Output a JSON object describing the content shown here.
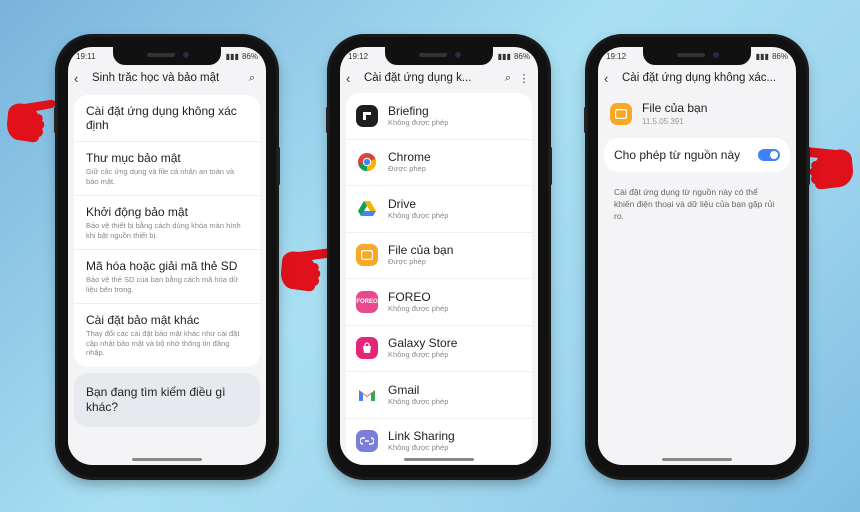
{
  "colors": {
    "accent": "#3e82f7",
    "hand": "#e0111b"
  },
  "phone1": {
    "status_time": "19:11",
    "battery": "86%",
    "toolbar_title": "Sinh trắc học và bảo mật",
    "items": [
      {
        "title": "Cài đặt ứng dụng không xác định",
        "subtitle": ""
      },
      {
        "title": "Thư mục bảo mật",
        "subtitle": "Giữ các ứng dụng và file cá nhân an toàn và bảo mật."
      },
      {
        "title": "Khởi động bảo mật",
        "subtitle": "Bảo vệ thiết bị bằng cách dùng khóa màn hình khi bật nguồn thiết bị."
      },
      {
        "title": "Mã hóa hoặc giải mã thẻ SD",
        "subtitle": "Bảo vệ thẻ SD của bạn bằng cách mã hóa dữ liệu bên trong."
      },
      {
        "title": "Cài đặt bảo mật khác",
        "subtitle": "Thay đổi các cài đặt bảo mật khác như cài đặt cập nhật bảo mật và bộ nhớ thông tin đăng nhập."
      }
    ],
    "search_prompt": "Bạn đang tìm kiếm điều gì khác?"
  },
  "phone2": {
    "status_time": "19:12",
    "battery": "86%",
    "toolbar_title": "Cài đặt ứng dụng k...",
    "apps": [
      {
        "name": "Briefing",
        "status": "Không được phép",
        "icon": "briefing-icon"
      },
      {
        "name": "Chrome",
        "status": "Được phép",
        "icon": "chrome-icon"
      },
      {
        "name": "Drive",
        "status": "Không được phép",
        "icon": "drive-icon"
      },
      {
        "name": "File của bạn",
        "status": "Được phép",
        "icon": "folder-icon"
      },
      {
        "name": "FOREO",
        "status": "Không được phép",
        "icon": "foreo-icon"
      },
      {
        "name": "Galaxy Store",
        "status": "Không được phép",
        "icon": "galaxy-store-icon"
      },
      {
        "name": "Gmail",
        "status": "Không được phép",
        "icon": "gmail-icon"
      },
      {
        "name": "Link Sharing",
        "status": "Không được phép",
        "icon": "link-sharing-icon"
      }
    ]
  },
  "phone3": {
    "status_time": "19:12",
    "battery": "86%",
    "toolbar_title": "Cài đặt ứng dụng không xác...",
    "app_name": "File của bạn",
    "app_version": "11.5.05.391",
    "toggle_label": "Cho phép từ nguồn này",
    "toggle_on": true,
    "warning": "Cài đặt ứng dụng từ nguồn này có thể khiến điện thoại và dữ liệu của bạn gặp rủi ro."
  }
}
